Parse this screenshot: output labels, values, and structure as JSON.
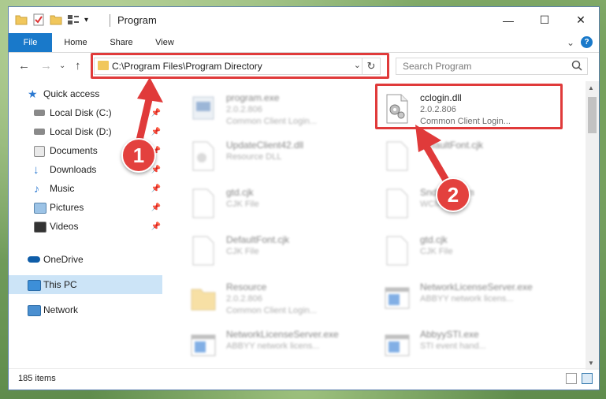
{
  "window": {
    "title": "Program",
    "controls": {
      "minimize": "—",
      "maximize": "☐",
      "close": "✕"
    }
  },
  "ribbon": {
    "tabs": [
      "File",
      "Home",
      "Share",
      "View"
    ],
    "help": "?",
    "collapse": "⌄"
  },
  "address": {
    "path": "C:\\Program Files\\Program Directory",
    "dropdown": "⌄",
    "refresh": "↻",
    "nav": {
      "back": "←",
      "forward": "→",
      "recent": "⌄",
      "up": "↑"
    }
  },
  "search": {
    "placeholder": "Search Program",
    "icon": "search-icon"
  },
  "sidebar": {
    "items": [
      {
        "label": "Quick access",
        "icon": "star-icon",
        "pinned": false,
        "selected": false
      },
      {
        "label": "Local Disk (C:)",
        "icon": "drive-icon",
        "pinned": true,
        "selected": false
      },
      {
        "label": "Local Disk (D:)",
        "icon": "drive-icon",
        "pinned": true,
        "selected": false
      },
      {
        "label": "Documents",
        "icon": "documents-icon",
        "pinned": true,
        "selected": false
      },
      {
        "label": "Downloads",
        "icon": "download-icon",
        "pinned": true,
        "selected": false
      },
      {
        "label": "Music",
        "icon": "music-icon",
        "pinned": true,
        "selected": false
      },
      {
        "label": "Pictures",
        "icon": "pictures-icon",
        "pinned": true,
        "selected": false
      },
      {
        "label": "Videos",
        "icon": "videos-icon",
        "pinned": true,
        "selected": false
      },
      {
        "label": "OneDrive",
        "icon": "cloud-icon",
        "pinned": false,
        "selected": false
      },
      {
        "label": "This PC",
        "icon": "computer-icon",
        "pinned": false,
        "selected": true
      },
      {
        "label": "Network",
        "icon": "network-icon",
        "pinned": false,
        "selected": false
      }
    ],
    "pin_glyph": "📌"
  },
  "files": [
    {
      "name": "program.exe",
      "line2": "2.0.2.806",
      "line3": "Common Client Login...",
      "icon": "exe-icon",
      "highlighted": false
    },
    {
      "name": "cclogin.dll",
      "line2": "2.0.2.806",
      "line3": "Common Client Login...",
      "icon": "dll-gear-icon",
      "highlighted": true
    },
    {
      "name": "UpdateClient42.dll",
      "line2": "Resource DLL",
      "line3": "",
      "icon": "dll-gear-icon",
      "highlighted": false
    },
    {
      "name": "DefaultFont.cjk",
      "line2": "",
      "line3": "",
      "icon": "file-icon",
      "highlighted": false
    },
    {
      "name": "gtd.cjk",
      "line2": "CJK File",
      "line3": "",
      "icon": "file-icon",
      "highlighted": false
    },
    {
      "name": "SndFile.wcm",
      "line2": "WCM File",
      "line3": "",
      "icon": "file-icon",
      "highlighted": false
    },
    {
      "name": "DefaultFont.cjk",
      "line2": "CJK File",
      "line3": "",
      "icon": "file-icon",
      "highlighted": false
    },
    {
      "name": "gtd.cjk",
      "line2": "CJK File",
      "line3": "",
      "icon": "file-icon",
      "highlighted": false
    },
    {
      "name": "Resource",
      "line2": "2.0.2.806",
      "line3": "Common Client Login...",
      "icon": "folder-icon",
      "highlighted": false
    },
    {
      "name": "NetworkLicenseServer.exe",
      "line2": "ABBYY network licens...",
      "line3": "",
      "icon": "app-window-icon",
      "highlighted": false
    },
    {
      "name": "NetworkLicenseServer.exe",
      "line2": "ABBYY network licens...",
      "line3": "",
      "icon": "app-window-icon",
      "highlighted": false
    },
    {
      "name": "AbbyySTI.exe",
      "line2": "STI event hand...",
      "line3": "",
      "icon": "app-window-icon",
      "highlighted": false
    }
  ],
  "status": {
    "item_count": "185 items"
  },
  "annotations": [
    {
      "number": "1"
    },
    {
      "number": "2"
    }
  ],
  "colors": {
    "accent": "#1979ca",
    "annotation_red": "#e03a3a",
    "selection": "#cce4f7",
    "folder_yellow": "#f1c75c"
  }
}
